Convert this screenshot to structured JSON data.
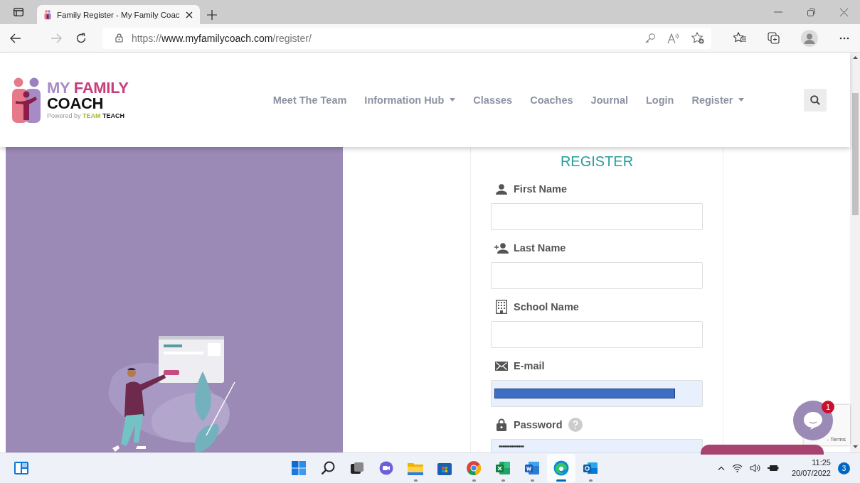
{
  "browser": {
    "tab": {
      "title": "Family Register - My Family Coac",
      "selected": true
    },
    "address": {
      "scheme": "https://",
      "host": "www.myfamilycoach.com",
      "path": "/register/"
    }
  },
  "header": {
    "logo": {
      "word_1": "MY",
      "word_2": "FAMILY",
      "word_3": "COACH",
      "powered": "Powered by",
      "brand_1": "TEAM",
      "brand_2": "TEACH"
    },
    "nav": [
      {
        "label": "Meet The Team",
        "dropdown": false
      },
      {
        "label": "Information Hub",
        "dropdown": true
      },
      {
        "label": "Classes",
        "dropdown": false
      },
      {
        "label": "Coaches",
        "dropdown": false
      },
      {
        "label": "Journal",
        "dropdown": false
      },
      {
        "label": "Login",
        "dropdown": false
      },
      {
        "label": "Register",
        "dropdown": true
      }
    ]
  },
  "form": {
    "title": "REGISTER",
    "fields": [
      {
        "label": "First Name",
        "kind": "person",
        "help": false,
        "autofilled": false,
        "redacted": false
      },
      {
        "label": "Last Name",
        "kind": "person-add",
        "help": false,
        "autofilled": false,
        "redacted": false
      },
      {
        "label": "School Name",
        "kind": "building",
        "help": false,
        "autofilled": false,
        "redacted": false
      },
      {
        "label": "E-mail",
        "kind": "mail",
        "help": false,
        "autofilled": true,
        "redacted": true
      },
      {
        "label": "Password",
        "kind": "lock",
        "help": true,
        "autofilled": true,
        "redacted": false,
        "value": "••••••••••••••"
      }
    ]
  },
  "chat": {
    "badge": "1"
  },
  "recaptcha": {
    "text": "- Terms"
  },
  "taskbar": {
    "apps": [
      {
        "kind": "windows",
        "running": false,
        "selected": false
      },
      {
        "kind": "search",
        "running": false,
        "selected": false
      },
      {
        "kind": "taskview",
        "running": false,
        "selected": false
      },
      {
        "kind": "teams",
        "running": false,
        "selected": false
      },
      {
        "kind": "explorer",
        "running": true,
        "selected": false
      },
      {
        "kind": "store",
        "running": false,
        "selected": false
      },
      {
        "kind": "chrome",
        "running": true,
        "selected": false
      },
      {
        "kind": "excel",
        "running": true,
        "selected": false
      },
      {
        "kind": "word",
        "running": true,
        "selected": false
      },
      {
        "kind": "edge",
        "running": true,
        "selected": true
      },
      {
        "kind": "outlook",
        "running": true,
        "selected": false
      }
    ],
    "time": "11:25",
    "date": "20/07/2022",
    "notifications": "3"
  }
}
